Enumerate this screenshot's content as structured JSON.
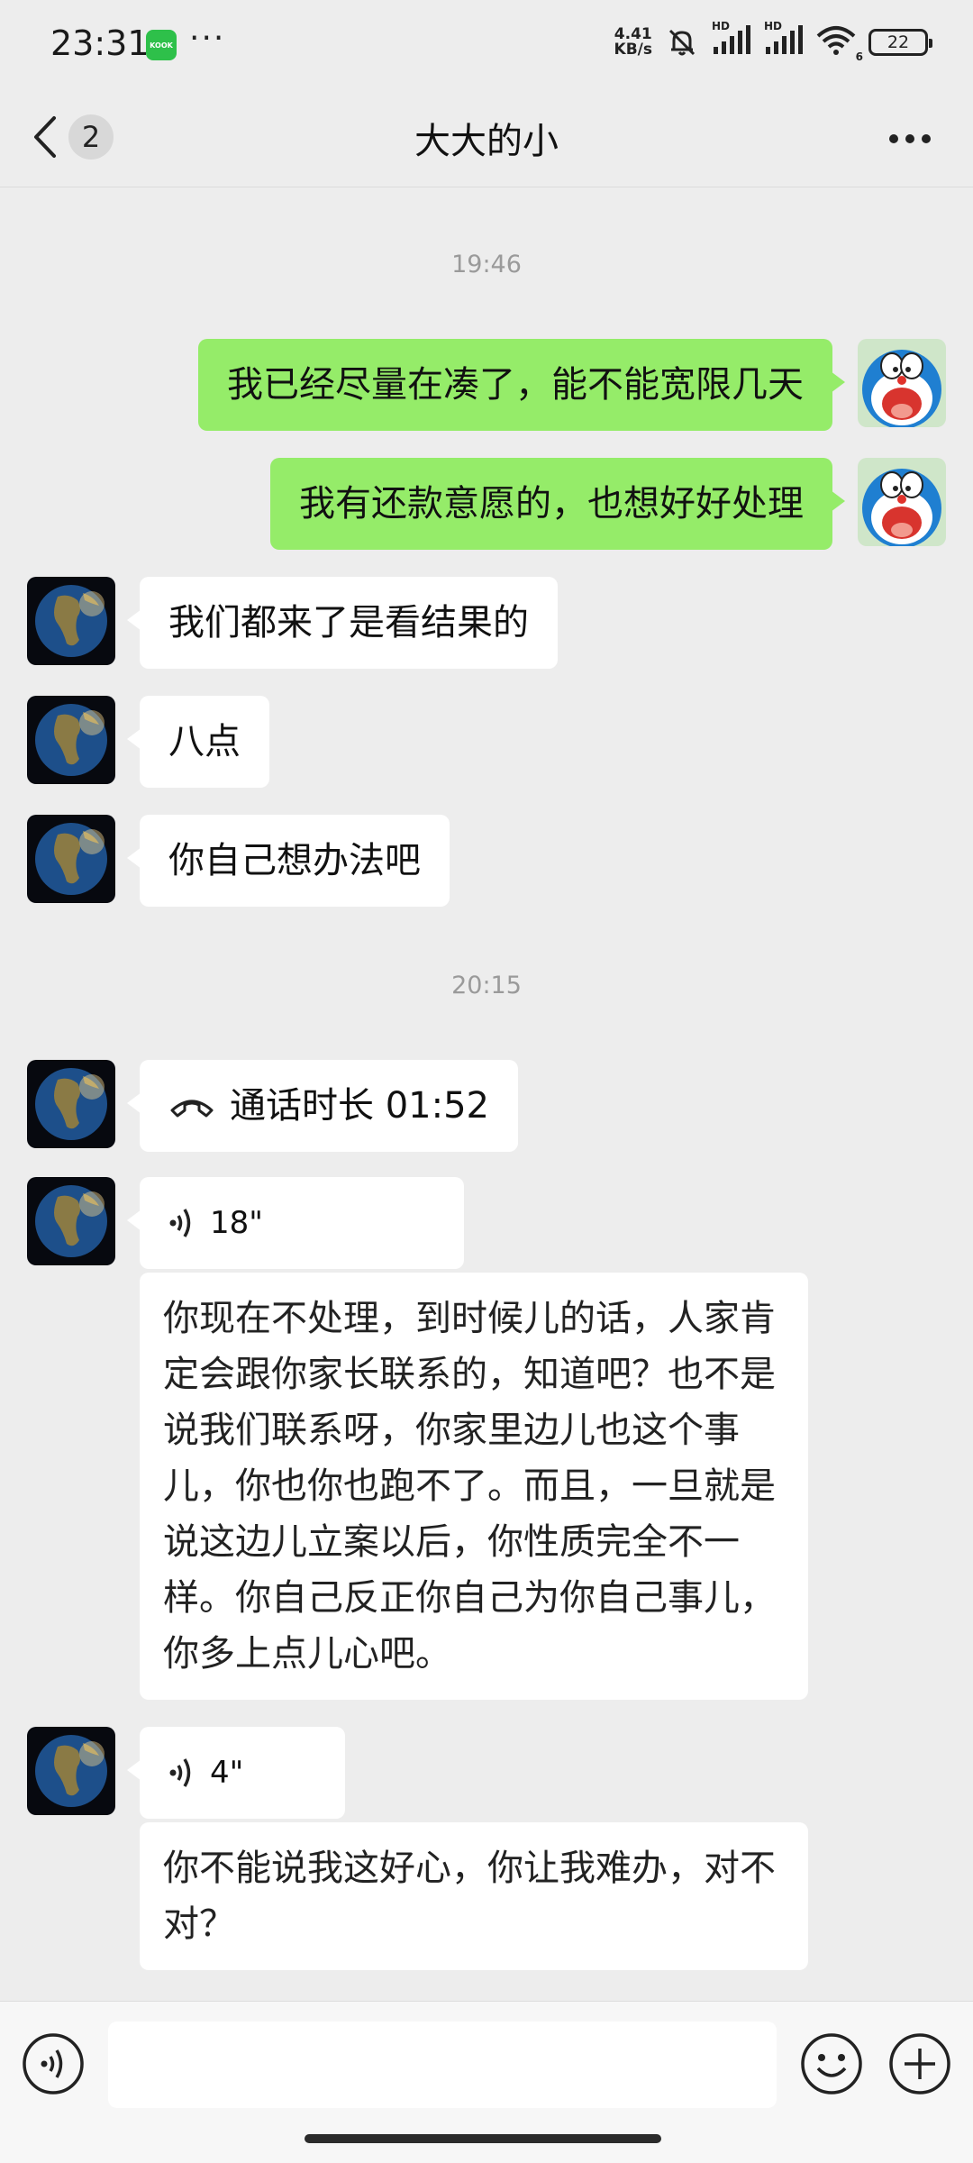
{
  "status_bar": {
    "time": "23:31",
    "app_badge": "KOOK",
    "dots": "···",
    "net_speed_value": "4.41",
    "net_speed_unit": "KB/s",
    "hd_label": "HD",
    "wifi_sub": "6",
    "battery": "22"
  },
  "nav": {
    "unread_count": "2",
    "title": "大大的小"
  },
  "messages": {
    "time1": "19:46",
    "out1": "我已经尽量在凑了，能不能宽限几天",
    "out2": "我有还款意愿的，也想好好处理",
    "in1": "我们都来了是看结果的",
    "in2": "八点",
    "in3": "你自己想办法吧",
    "time2": "20:15",
    "call_label": "通话时长 01:52",
    "voice1_duration": "18\"",
    "voice1_transcript": "你现在不处理，到时候儿的话，人家肯定会跟你家长联系的，知道吧？也不是说我们联系呀，你家里边儿也这个事儿，你也你也跑不了。而且，一旦就是说这边儿立案以后，你性质完全不一样。你自己反正你自己为你自己事儿，你多上点儿心吧。",
    "voice2_duration": "4\"",
    "voice2_transcript": "你不能说我这好心，你让我难办，对不对？"
  },
  "input": {
    "placeholder": ""
  },
  "colors": {
    "out_bubble": "#95ec69",
    "in_bubble": "#ffffff",
    "background": "#ededed"
  },
  "icons": {
    "back": "chevron-left-icon",
    "more": "more-icon",
    "call": "phone-hangup-icon",
    "voice": "voice-wave-icon",
    "voice_toggle": "voice-input-icon",
    "emoji": "emoji-icon",
    "add": "plus-icon"
  }
}
